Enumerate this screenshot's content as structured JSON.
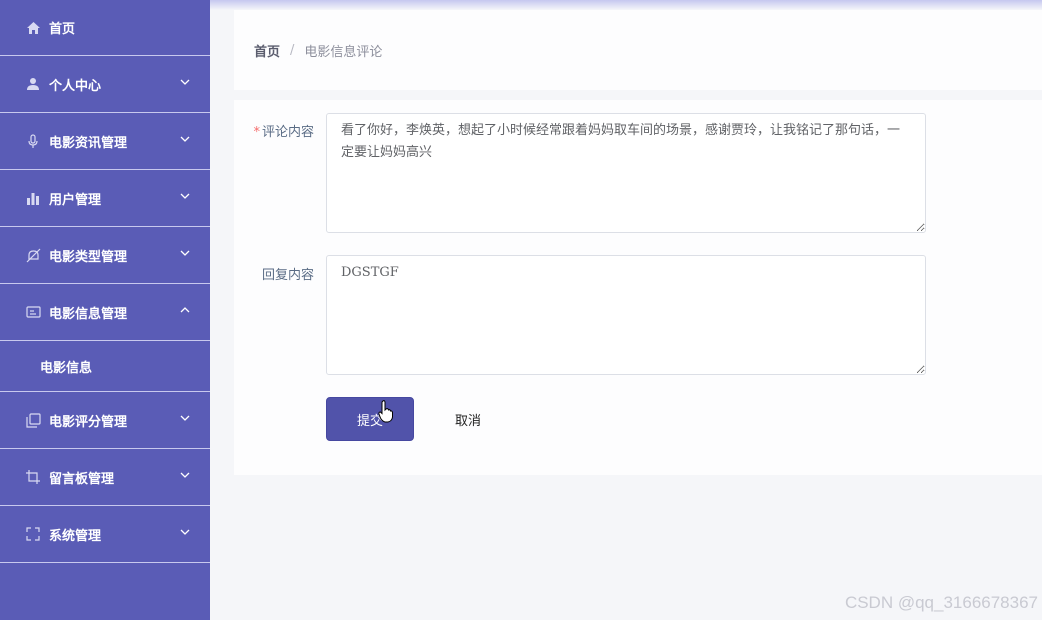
{
  "sidebar": {
    "items": [
      {
        "label": "首页",
        "icon": "home-icon",
        "has_chevron": false
      },
      {
        "label": "个人中心",
        "icon": "user-icon",
        "has_chevron": true,
        "expanded": false
      },
      {
        "label": "电影资讯管理",
        "icon": "microphone-icon",
        "has_chevron": true,
        "expanded": false
      },
      {
        "label": "用户管理",
        "icon": "bar-chart-icon",
        "has_chevron": true,
        "expanded": false
      },
      {
        "label": "电影类型管理",
        "icon": "bell-off-icon",
        "has_chevron": true,
        "expanded": false
      },
      {
        "label": "电影信息管理",
        "icon": "id-card-icon",
        "has_chevron": true,
        "expanded": true
      },
      {
        "label": "电影评分管理",
        "icon": "copy-icon",
        "has_chevron": true,
        "expanded": false
      },
      {
        "label": "留言板管理",
        "icon": "crop-icon",
        "has_chevron": true,
        "expanded": false
      },
      {
        "label": "系统管理",
        "icon": "fullscreen-icon",
        "has_chevron": true,
        "expanded": false
      }
    ],
    "submenu": {
      "label": "电影信息"
    }
  },
  "breadcrumb": {
    "home": "首页",
    "separator": "/",
    "current": "电影信息评论"
  },
  "form": {
    "comment": {
      "label": "评论内容",
      "required_mark": "*",
      "value": "看了你好，李焕英，想起了小时候经常跟着妈妈取车间的场景，感谢贾玲，让我铭记了那句话，一定要让妈妈高兴"
    },
    "reply": {
      "label": "回复内容",
      "value": "DGSTGF"
    },
    "submit_label": "提交",
    "cancel_label": "取消"
  },
  "watermark": "CSDN @qq_3166678367",
  "colors": {
    "sidebar_bg": "#5a5cb6",
    "submit_bg": "#5153aa",
    "required": "#f56c6c",
    "page_bg": "#f5f6f9"
  }
}
